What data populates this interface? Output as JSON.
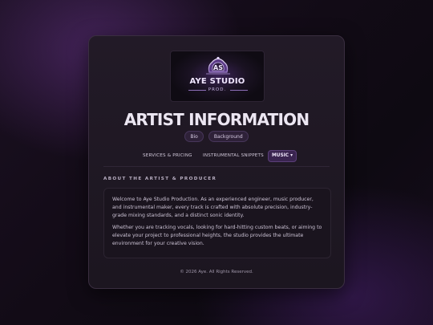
{
  "logo": {
    "title": "AYE STUDIO",
    "subtitle": "PROD."
  },
  "page": {
    "title": "ARTIST INFORMATION"
  },
  "pills": [
    {
      "label": "Bio"
    },
    {
      "label": "Background"
    }
  ],
  "nav": {
    "services_label": "SERVICES & PRICING",
    "snippets_label": "INSTRUMENTAL SNIPPETS",
    "music_label": "MUSIC",
    "music_caret": "▾"
  },
  "section": {
    "heading": "ABOUT THE ARTIST & PRODUCER",
    "paragraphs": [
      "Welcome to Aye Studio Production. As an experienced engineer, music producer, and instrumental maker, every track is crafted with absolute precision, industry-grade mixing standards, and a distinct sonic identity.",
      "Whether you are tracking vocals, looking for hard-hitting custom beats, or aiming to elevate your project to professional heights, the studio provides the ultimate environment for your creative vision."
    ]
  },
  "footer": {
    "text": "© 2026 Aye. All Rights Reserved."
  },
  "colors": {
    "accent": "#3a2450",
    "card_bg": "#1f1823",
    "text": "#ece6f2"
  }
}
